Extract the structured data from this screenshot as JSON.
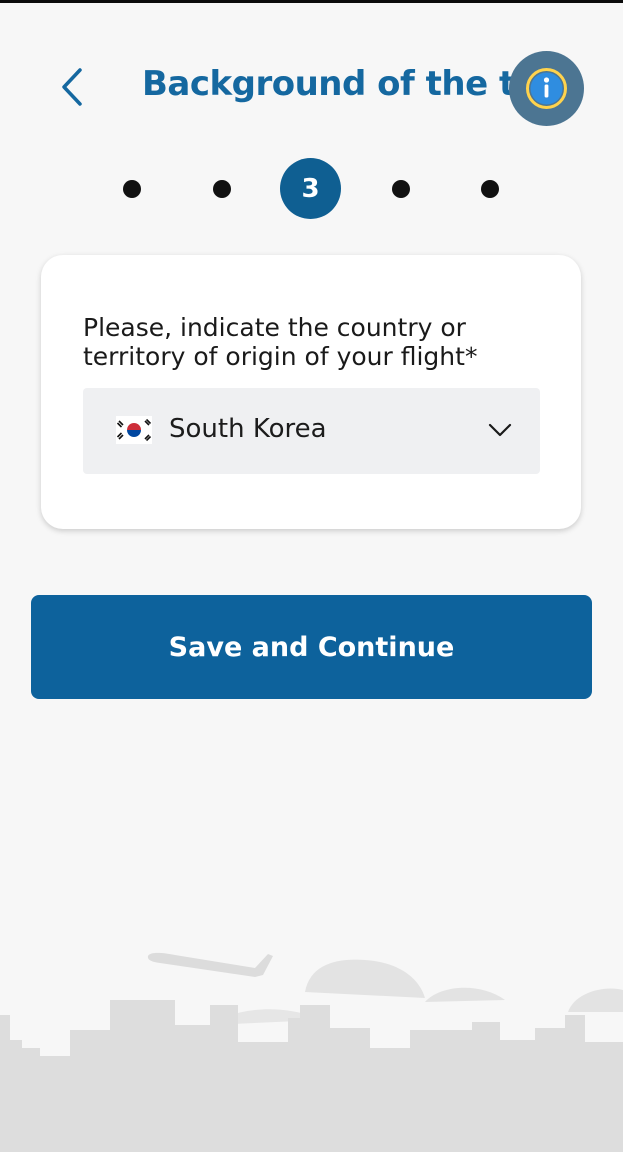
{
  "header": {
    "title": "Background of the trip",
    "back_icon": "chevron-left-icon",
    "info_icon": "info-icon"
  },
  "stepper": {
    "current_step": "3",
    "total_steps": 5
  },
  "form": {
    "question": "Please, indicate the country or territory of origin of your flight*",
    "country_select": {
      "value": "South Korea",
      "flag_icon": "south-korea-flag-icon",
      "dropdown_icon": "chevron-down-icon"
    }
  },
  "actions": {
    "save_label": "Save and Continue"
  },
  "colors": {
    "primary": "#0d629c",
    "title": "#1568a0",
    "info_button": "#4c7592",
    "background": "#f7f7f7",
    "skyline": "#dedede"
  }
}
